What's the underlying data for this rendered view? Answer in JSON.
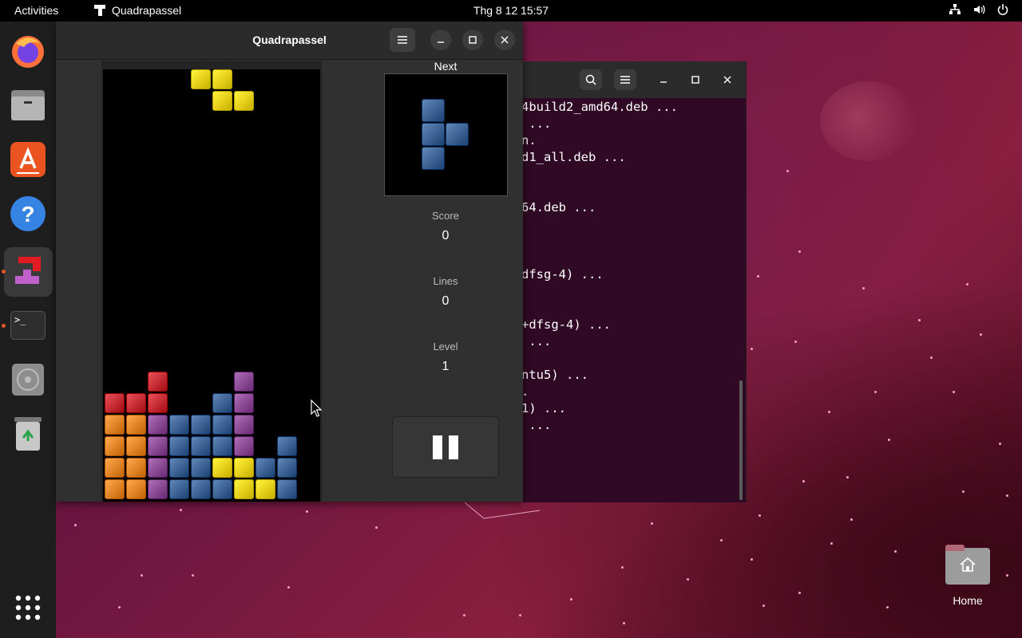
{
  "topbar": {
    "activities": "Activities",
    "app_name": "Quadrapassel",
    "clock": "Thg 8 12  15:57",
    "tray_icons": [
      "network-icon",
      "volume-icon",
      "power-icon"
    ]
  },
  "dock": {
    "items": [
      {
        "name": "firefox-icon"
      },
      {
        "name": "files-icon"
      },
      {
        "name": "app-center-icon"
      },
      {
        "name": "help-icon"
      },
      {
        "name": "quadrapassel-icon",
        "active": true
      },
      {
        "name": "terminal-icon",
        "text": ">_"
      },
      {
        "name": "disc-icon"
      },
      {
        "name": "trash-icon"
      },
      {
        "name": "show-apps-icon"
      }
    ]
  },
  "quadrapassel": {
    "title": "Quadrapassel",
    "next_label": "Next",
    "score_label": "Score",
    "score": "0",
    "lines_label": "Lines",
    "lines": "0",
    "level_label": "Level",
    "level": "1",
    "colors": {
      "yellow": "#e8d21d",
      "blue": "#3f6596",
      "red": "#c72e35",
      "orange": "#e3862a",
      "purple": "#8d4d96"
    },
    "falling_piece": {
      "color": "yellow",
      "cells": [
        [
          4,
          0
        ],
        [
          5,
          0
        ],
        [
          5,
          1
        ],
        [
          6,
          1
        ]
      ]
    },
    "next_piece": {
      "color": "blue",
      "cells": [
        [
          0,
          0
        ],
        [
          0,
          1
        ],
        [
          1,
          1
        ],
        [
          0,
          2
        ]
      ]
    },
    "stack": [
      {
        "c": 2,
        "r": 14,
        "color": "red"
      },
      {
        "c": 6,
        "r": 14,
        "color": "purple"
      },
      {
        "c": 0,
        "r": 15,
        "color": "red"
      },
      {
        "c": 1,
        "r": 15,
        "color": "red"
      },
      {
        "c": 2,
        "r": 15,
        "color": "red"
      },
      {
        "c": 5,
        "r": 15,
        "color": "blue"
      },
      {
        "c": 6,
        "r": 15,
        "color": "purple"
      },
      {
        "c": 0,
        "r": 16,
        "color": "orange"
      },
      {
        "c": 1,
        "r": 16,
        "color": "orange"
      },
      {
        "c": 2,
        "r": 16,
        "color": "purple"
      },
      {
        "c": 3,
        "r": 16,
        "color": "blue"
      },
      {
        "c": 4,
        "r": 16,
        "color": "blue"
      },
      {
        "c": 5,
        "r": 16,
        "color": "blue"
      },
      {
        "c": 6,
        "r": 16,
        "color": "purple"
      },
      {
        "c": 0,
        "r": 17,
        "color": "orange"
      },
      {
        "c": 1,
        "r": 17,
        "color": "orange"
      },
      {
        "c": 2,
        "r": 17,
        "color": "purple"
      },
      {
        "c": 3,
        "r": 17,
        "color": "blue"
      },
      {
        "c": 4,
        "r": 17,
        "color": "blue"
      },
      {
        "c": 5,
        "r": 17,
        "color": "blue"
      },
      {
        "c": 6,
        "r": 17,
        "color": "purple"
      },
      {
        "c": 8,
        "r": 17,
        "color": "blue"
      },
      {
        "c": 0,
        "r": 18,
        "color": "orange"
      },
      {
        "c": 1,
        "r": 18,
        "color": "orange"
      },
      {
        "c": 2,
        "r": 18,
        "color": "purple"
      },
      {
        "c": 3,
        "r": 18,
        "color": "blue"
      },
      {
        "c": 4,
        "r": 18,
        "color": "blue"
      },
      {
        "c": 5,
        "r": 18,
        "color": "yellow"
      },
      {
        "c": 6,
        "r": 18,
        "color": "yellow"
      },
      {
        "c": 7,
        "r": 18,
        "color": "blue"
      },
      {
        "c": 8,
        "r": 18,
        "color": "blue"
      },
      {
        "c": 0,
        "r": 19,
        "color": "orange"
      },
      {
        "c": 1,
        "r": 19,
        "color": "orange"
      },
      {
        "c": 2,
        "r": 19,
        "color": "purple"
      },
      {
        "c": 3,
        "r": 19,
        "color": "blue"
      },
      {
        "c": 4,
        "r": 19,
        "color": "blue"
      },
      {
        "c": 5,
        "r": 19,
        "color": "blue"
      },
      {
        "c": 6,
        "r": 19,
        "color": "yellow"
      },
      {
        "c": 7,
        "r": 19,
        "color": "yellow"
      },
      {
        "c": 8,
        "r": 19,
        "color": "blue"
      }
    ]
  },
  "terminal": {
    "lines": [
      {
        "row": 0,
        "text": "4build2_amd64.deb ..."
      },
      {
        "row": 1,
        "text": " ..."
      },
      {
        "row": 2,
        "text": "n."
      },
      {
        "row": 3,
        "text": "d1_all.deb ..."
      },
      {
        "row": 6,
        "text": "64.deb ..."
      },
      {
        "row": 10,
        "text": "dfsg-4) ..."
      },
      {
        "row": 13,
        "text": "+dfsg-4) ..."
      },
      {
        "row": 14,
        "text": " ..."
      },
      {
        "row": 16,
        "text": "ntu5) ..."
      },
      {
        "row": 17,
        "text": "."
      },
      {
        "row": 18,
        "text": "1) ..."
      },
      {
        "row": 19,
        "text": " ..."
      }
    ]
  },
  "desktop": {
    "home_label": "Home"
  }
}
